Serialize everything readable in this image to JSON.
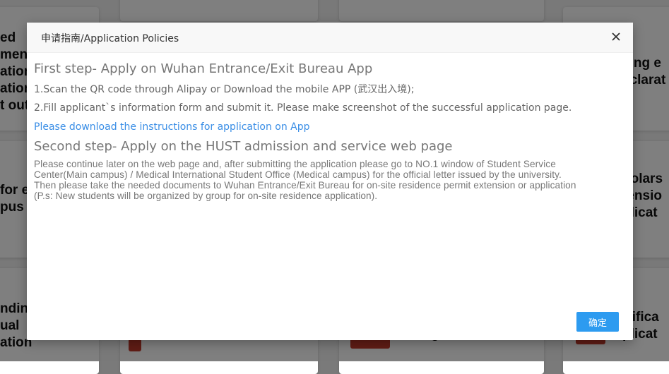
{
  "background": {
    "card_texts": [
      [
        "ed",
        "ments",
        "ation",
        "ation",
        "t out"
      ],
      [
        "for e",
        "pus"
      ],
      [
        "ndin",
        "ual",
        "ation"
      ],
      [
        "ving e",
        "eclarat"
      ],
      [
        "holars",
        "tensio",
        "plicat"
      ],
      [
        "rtifica",
        "plicat"
      ],
      [
        "g"
      ]
    ]
  },
  "modal": {
    "title": "申请指南/Application Policies",
    "step1": {
      "heading": "First step- Apply on Wuhan Entrance/Exit Bureau App",
      "line1": "1.Scan the QR code through Alipay or Download the mobile APP (武汉出入境);",
      "line2": "2.Fill applicant`s information form and submit it. Please make screenshot of the successful application page.",
      "link": "Please download the instructions for application on App"
    },
    "step2": {
      "heading": "Second step- Apply on the HUST admission and service web page",
      "lines": [
        "Please continue later on the web page and, after submitting the application please go to NO.1 window of Student Service",
        "Center(Main campus) / Medical International Student Office (Medical campus) for the official letter issued by the university.",
        "Then please take the needed documents to Wuhan Entrance/Exit Bureau for on-site residence permit extension or application",
        "(P.s: New students will be organized by group for on-site residence application)."
      ]
    },
    "confirm_label": "确定",
    "close_icon": "close-icon"
  },
  "colors": {
    "link": "#3a8ee6",
    "confirm_button": "#2d9bf0",
    "heading": "#777777"
  }
}
